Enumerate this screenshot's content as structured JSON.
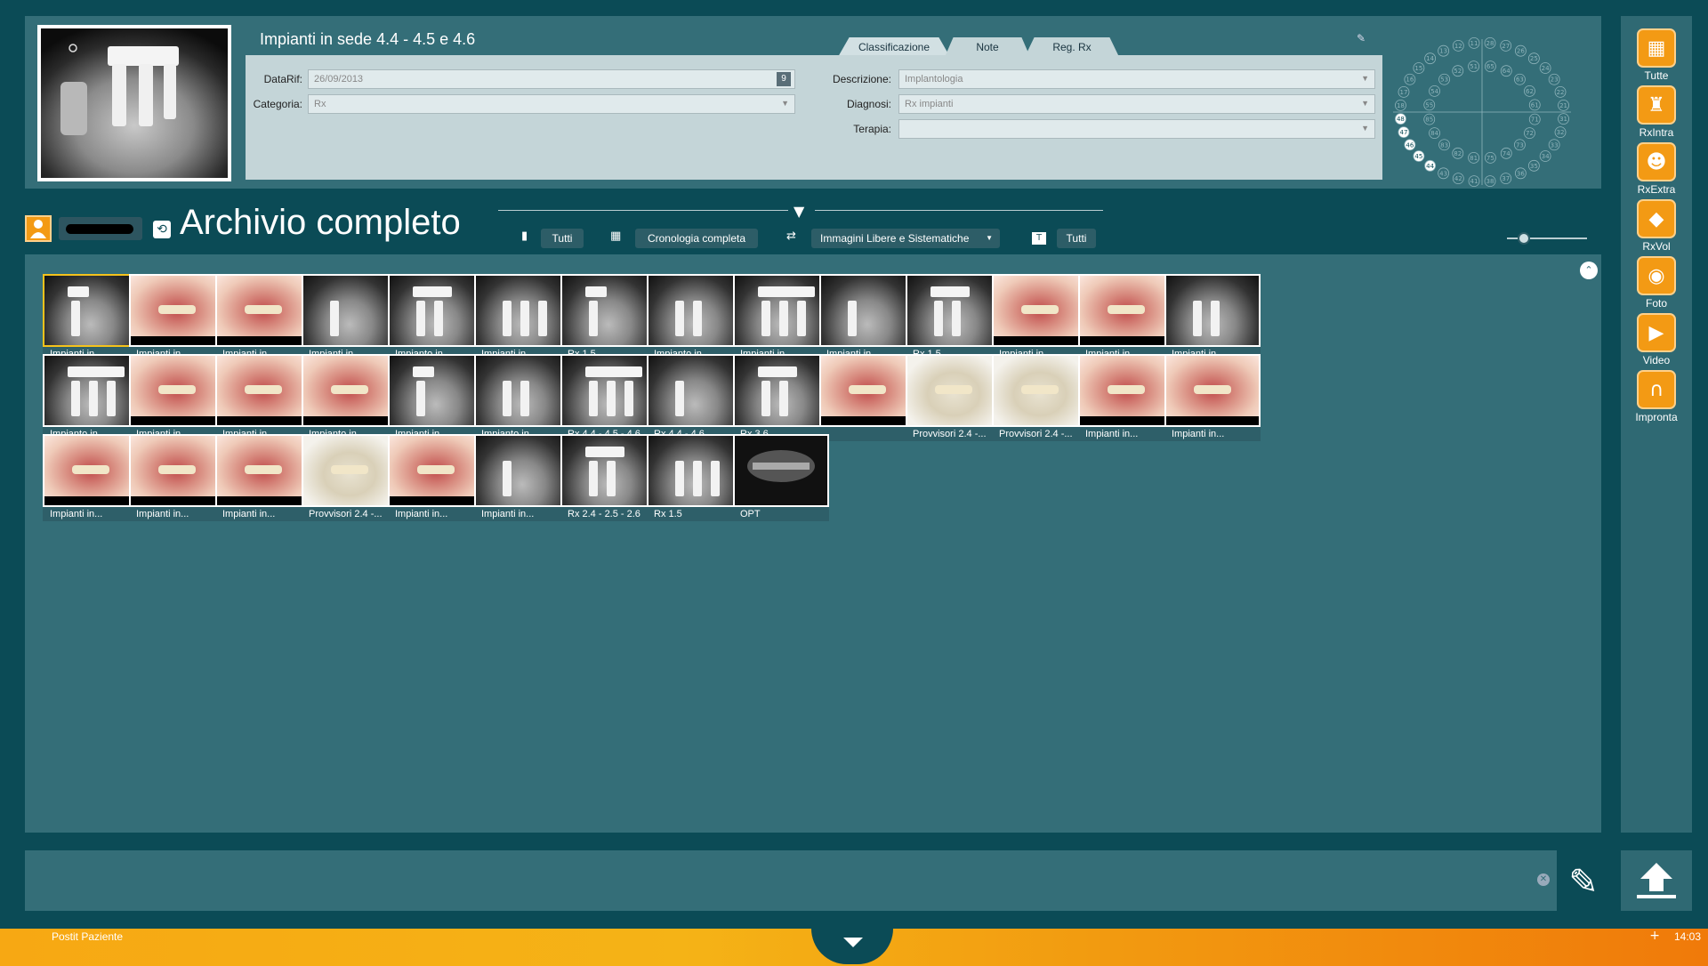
{
  "record": {
    "title": "Impianti in sede 4.4 - 4.5 e 4.6",
    "tabs": [
      "Classificazione",
      "Note",
      "Reg. Rx"
    ],
    "fields": {
      "datarif_label": "DataRif:",
      "datarif_value": "26/09/2013",
      "calendar_day": "9",
      "categoria_label": "Categoria:",
      "categoria_value": "Rx",
      "descrizione_label": "Descrizione:",
      "descrizione_value": "Implantologia",
      "diagnosi_label": "Diagnosi:",
      "diagnosi_value": "Rx impianti",
      "terapia_label": "Terapia:",
      "terapia_value": ""
    }
  },
  "tooth_chart": {
    "upper_right": [
      "18",
      "17",
      "16",
      "15",
      "14",
      "13",
      "12",
      "11"
    ],
    "upper_left": [
      "21",
      "22",
      "23",
      "24",
      "25",
      "26",
      "27",
      "28"
    ],
    "upper_right_deciduous": [
      "55",
      "54",
      "53",
      "52",
      "51"
    ],
    "upper_left_deciduous": [
      "61",
      "62",
      "63",
      "64",
      "65"
    ],
    "lower_right": [
      "48",
      "47",
      "46",
      "45",
      "44",
      "43",
      "42",
      "41"
    ],
    "lower_left": [
      "31",
      "32",
      "33",
      "34",
      "35",
      "36",
      "37",
      "38"
    ],
    "lower_right_deciduous": [
      "85",
      "84",
      "83",
      "82",
      "81"
    ],
    "lower_left_deciduous": [
      "71",
      "72",
      "73",
      "74",
      "75"
    ],
    "highlighted": [
      "48",
      "47",
      "46",
      "45",
      "44"
    ]
  },
  "archive": {
    "title": "Archivio completo",
    "filters": {
      "teeth": "Tutti",
      "chronology": "Cronologia completa",
      "image_type": "Immagini Libere e Sistematiche",
      "text": "Tutti"
    }
  },
  "thumbnails": [
    {
      "caption": "Impianti in...",
      "kind": "xray",
      "selected": true
    },
    {
      "caption": "Impianti in...",
      "kind": "photo"
    },
    {
      "caption": "Impianti in...",
      "kind": "photo"
    },
    {
      "caption": "Impianti in...",
      "kind": "xray"
    },
    {
      "caption": "Impianto in...",
      "kind": "xray"
    },
    {
      "caption": "Impianti in...",
      "kind": "xray"
    },
    {
      "caption": "Rx 1.5",
      "kind": "xray"
    },
    {
      "caption": "Impianto in...",
      "kind": "xray"
    },
    {
      "caption": "Impianti in...",
      "kind": "xray"
    },
    {
      "caption": "Impianti in...",
      "kind": "xray"
    },
    {
      "caption": "Rx 1.5",
      "kind": "xray"
    },
    {
      "caption": "Impianti in...",
      "kind": "photo"
    },
    {
      "caption": "Impianti in...",
      "kind": "photo"
    },
    {
      "caption": "Impianti in...",
      "kind": "xray"
    },
    {
      "caption": "Impianto in...",
      "kind": "xray"
    },
    {
      "caption": "Impianti in...",
      "kind": "photo"
    },
    {
      "caption": "Impianti in...",
      "kind": "photo"
    },
    {
      "caption": "Impianto in...",
      "kind": "photo"
    },
    {
      "caption": "Impianti in...",
      "kind": "xray"
    },
    {
      "caption": "Impianto in...",
      "kind": "xray"
    },
    {
      "caption": "Rx 4.4 - 4.5 - 4.6",
      "kind": "xray"
    },
    {
      "caption": "Rx 4.4 - 4.6",
      "kind": "xray"
    },
    {
      "caption": "Rx 3.6",
      "kind": "xray"
    },
    {
      "caption": "",
      "kind": "photo"
    },
    {
      "caption": "Provvisori 2.4 -...",
      "kind": "cast"
    },
    {
      "caption": "Provvisori 2.4 -...",
      "kind": "cast"
    },
    {
      "caption": "Impianti in...",
      "kind": "photo"
    },
    {
      "caption": "Impianti in...",
      "kind": "photo"
    },
    {
      "caption": "Impianti in...",
      "kind": "photo"
    },
    {
      "caption": "Impianti in...",
      "kind": "photo"
    },
    {
      "caption": "Impianti in...",
      "kind": "photo"
    },
    {
      "caption": "Provvisori 2.4 -...",
      "kind": "cast"
    },
    {
      "caption": "Impianti in...",
      "kind": "photo"
    },
    {
      "caption": "Impianti in...",
      "kind": "xray"
    },
    {
      "caption": "Rx 2.4 - 2.5 - 2.6",
      "kind": "xray"
    },
    {
      "caption": "Rx 1.5",
      "kind": "xray"
    },
    {
      "caption": "OPT",
      "kind": "opt"
    }
  ],
  "right_rail": [
    {
      "label": "Tutte",
      "icon": "all-images-icon"
    },
    {
      "label": "RxIntra",
      "icon": "tooth-icon"
    },
    {
      "label": "RxExtra",
      "icon": "head-profile-icon"
    },
    {
      "label": "RxVol",
      "icon": "cube-icon"
    },
    {
      "label": "Foto",
      "icon": "camera-icon"
    },
    {
      "label": "Video",
      "icon": "video-camera-icon"
    },
    {
      "label": "Impronta",
      "icon": "dental-arch-icon"
    }
  ],
  "statusbar": {
    "postit": "Postit Paziente",
    "time": "14:03"
  },
  "colors": {
    "background": "#0b4b56",
    "panel": "#346e78",
    "accent": "#f39a14",
    "selected": "#f4c21c"
  }
}
